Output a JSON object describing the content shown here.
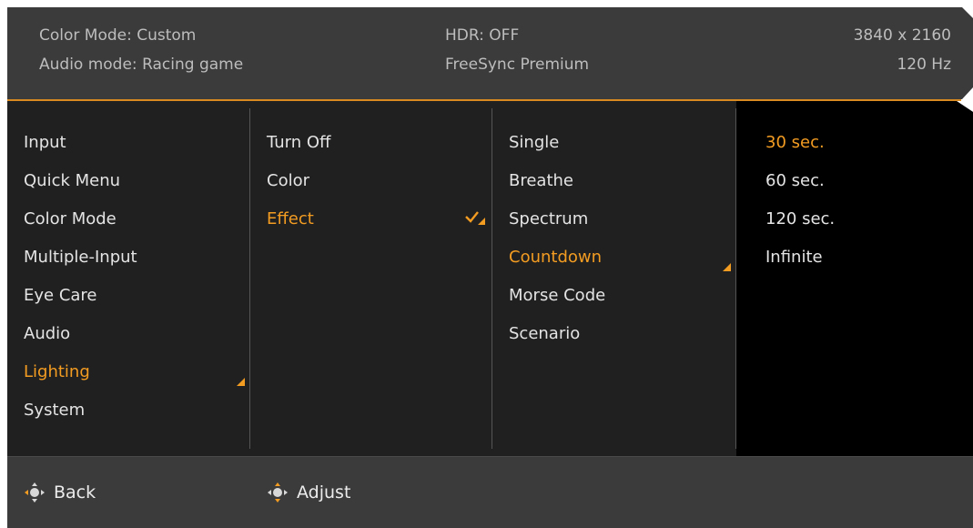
{
  "header": {
    "color_mode": "Color Mode: Custom",
    "audio_mode": "Audio mode: Racing game",
    "hdr": "HDR: OFF",
    "freesync": "FreeSync Premium",
    "resolution": "3840 x 2160",
    "refresh_rate": "120 Hz"
  },
  "menu": {
    "main_items": [
      "Input",
      "Quick Menu",
      "Color Mode",
      "Multiple-Input",
      "Eye Care",
      "Audio",
      "Lighting",
      "System"
    ],
    "main_selected": "Lighting",
    "lighting_items": [
      "Turn Off",
      "Color",
      "Effect"
    ],
    "lighting_selected": "Effect",
    "effect_items": [
      "Single",
      "Breathe",
      "Spectrum",
      "Countdown",
      "Morse Code",
      "Scenario"
    ],
    "effect_selected": "Countdown",
    "countdown_items": [
      "30 sec.",
      "60 sec.",
      "120 sec.",
      "Infinite"
    ],
    "countdown_selected": "30 sec."
  },
  "footer": {
    "back_label": "Back",
    "adjust_label": "Adjust"
  },
  "colors": {
    "accent": "#f39c22",
    "header_bg": "#3b3b3b",
    "body_bg": "#202020",
    "value_bg": "#000000"
  },
  "icons": {
    "selected_marker": "triangle-marker-icon",
    "checked": "checkmark-icon",
    "joystick": "joystick-icon"
  }
}
